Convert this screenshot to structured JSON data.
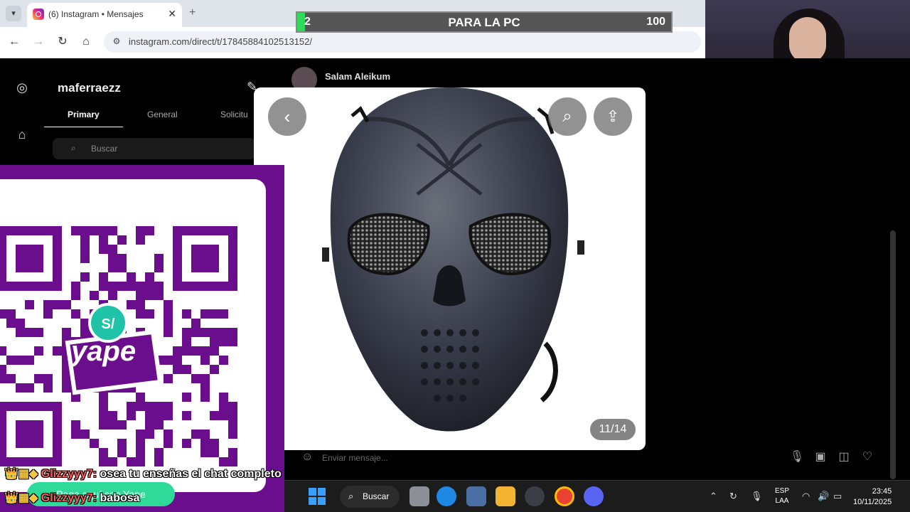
{
  "browser": {
    "tab_menu_icon": "chevron-down-icon",
    "tab_title": "(6) Instagram • Mensajes",
    "tab_close": "✕",
    "new_tab": "+",
    "url": "instagram.com/direct/t/17845884102513152/"
  },
  "goal": {
    "current": "2",
    "label": "PARA LA PC",
    "max": "100",
    "progress": 0.02,
    "color": "#2fd95a"
  },
  "instagram": {
    "username": "maferraezz",
    "tabs": [
      "Primary",
      "General",
      "Solicitu"
    ],
    "search_placeholder": "Buscar",
    "chat_name": "Salam Aleikum",
    "message_placeholder": "Enviar mensaje...",
    "viewer_counter": "11/14"
  },
  "qr": {
    "brand_text": "yape",
    "currency_symbol": "S/",
    "cta": "Paga aquí con Yape",
    "accent": "#6a0e8e"
  },
  "chat": [
    {
      "user": "Glizzyyy7:",
      "message": "osea tu enseñas el chat completo"
    },
    {
      "user": "Glizzyyy7:",
      "message": "babosa"
    }
  ],
  "taskbar": {
    "search_label": "Buscar",
    "lang_line1": "ESP",
    "lang_line2": "LAA",
    "time": "23:45",
    "date": "10/11/2025"
  }
}
